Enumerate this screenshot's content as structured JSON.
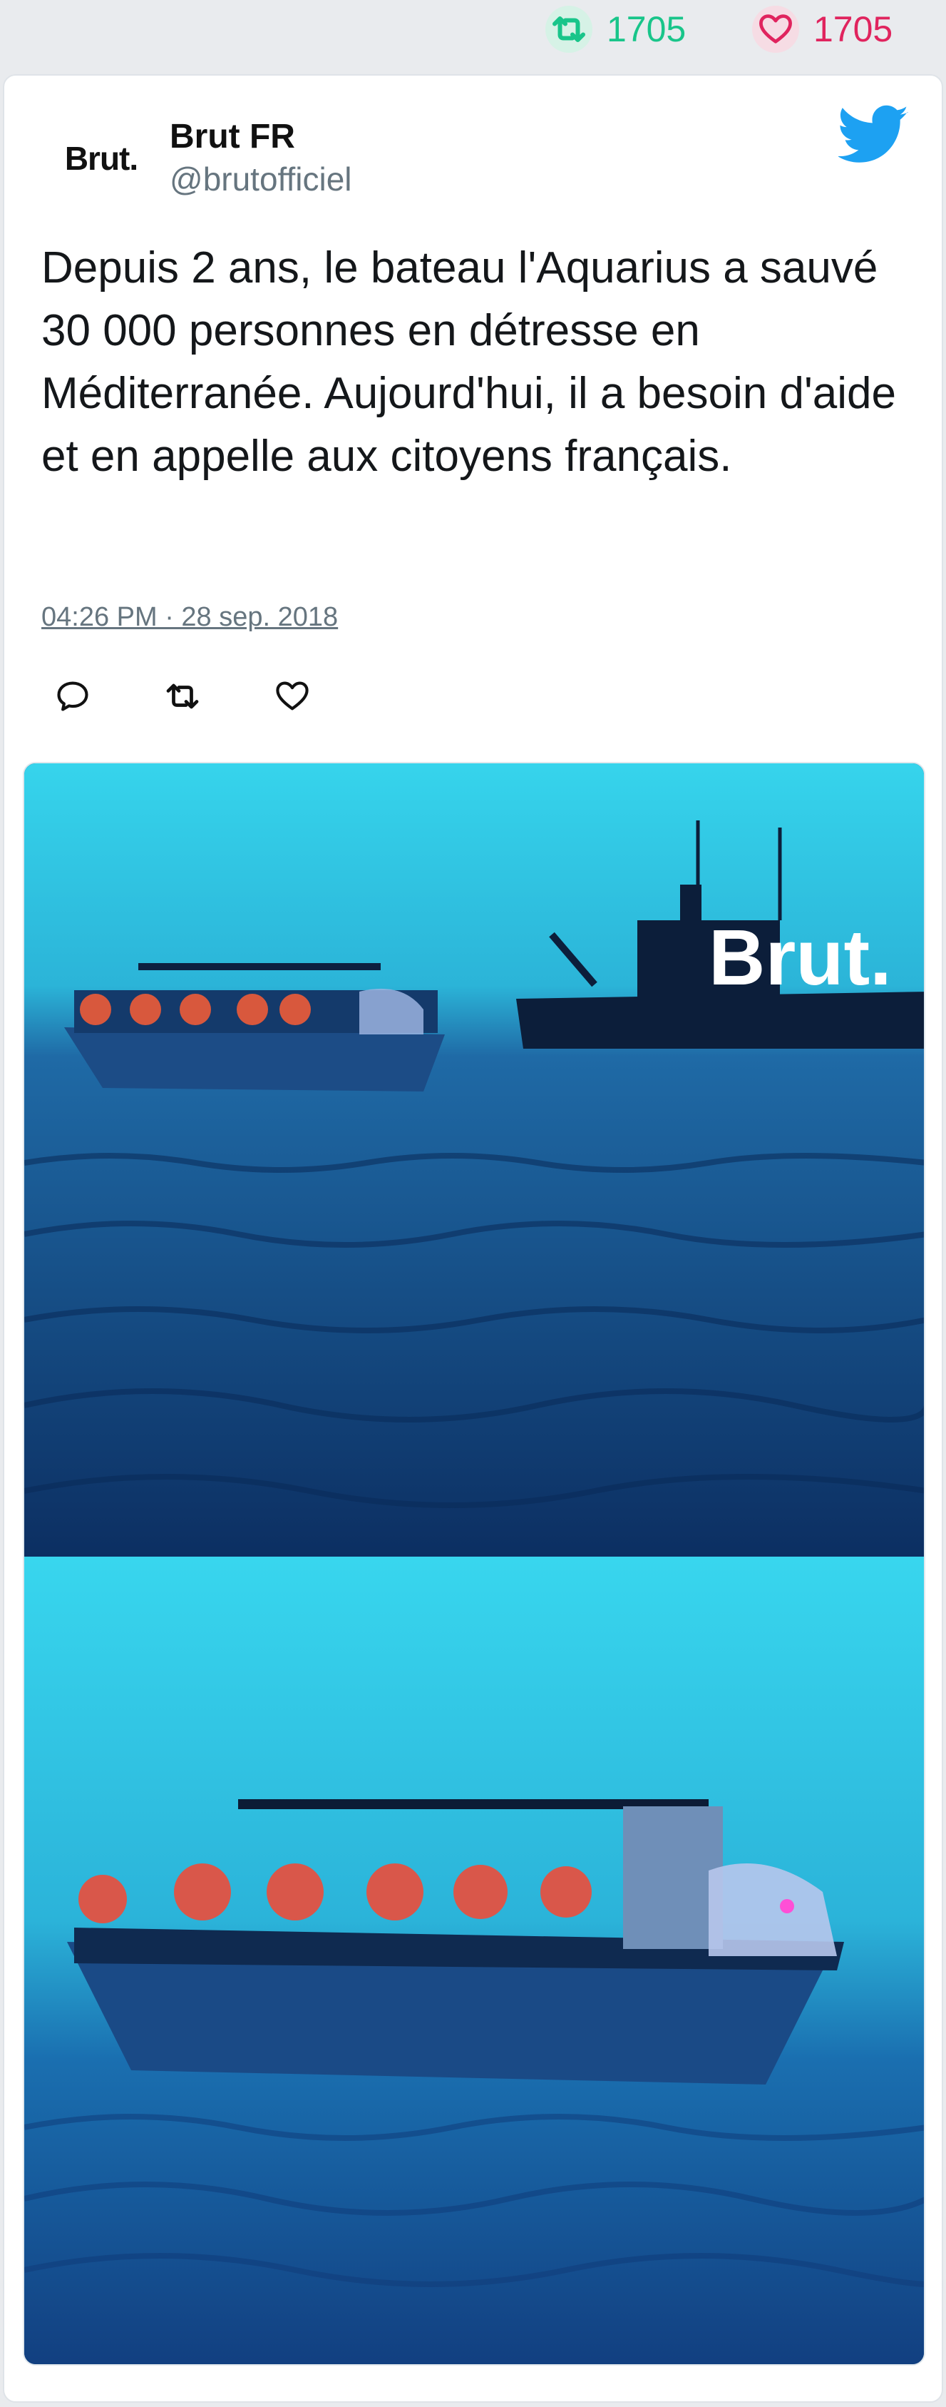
{
  "stats": {
    "retweet_count": "1705",
    "like_count": "1705",
    "retweet_color": "#19c58a",
    "like_color": "#e0245e"
  },
  "tweet": {
    "avatar_text": "Brut.",
    "display_name": "Brut FR",
    "handle": "@brutofficiel",
    "text": "Depuis 2 ans, le bateau l'Aquarius a sauvé 30 000 personnes en détresse en Méditerranée. Aujourd'hui, il a besoin d'aide et en appelle aux citoyens français.",
    "timestamp": "04:26 PM · 28 sep. 2018",
    "brand_icon": "twitter-bird-icon",
    "brand_color": "#1da1f2"
  },
  "actions": {
    "reply_icon": "reply-icon",
    "retweet_icon": "retweet-icon",
    "like_icon": "heart-icon"
  },
  "media": {
    "watermark": "Brut."
  }
}
